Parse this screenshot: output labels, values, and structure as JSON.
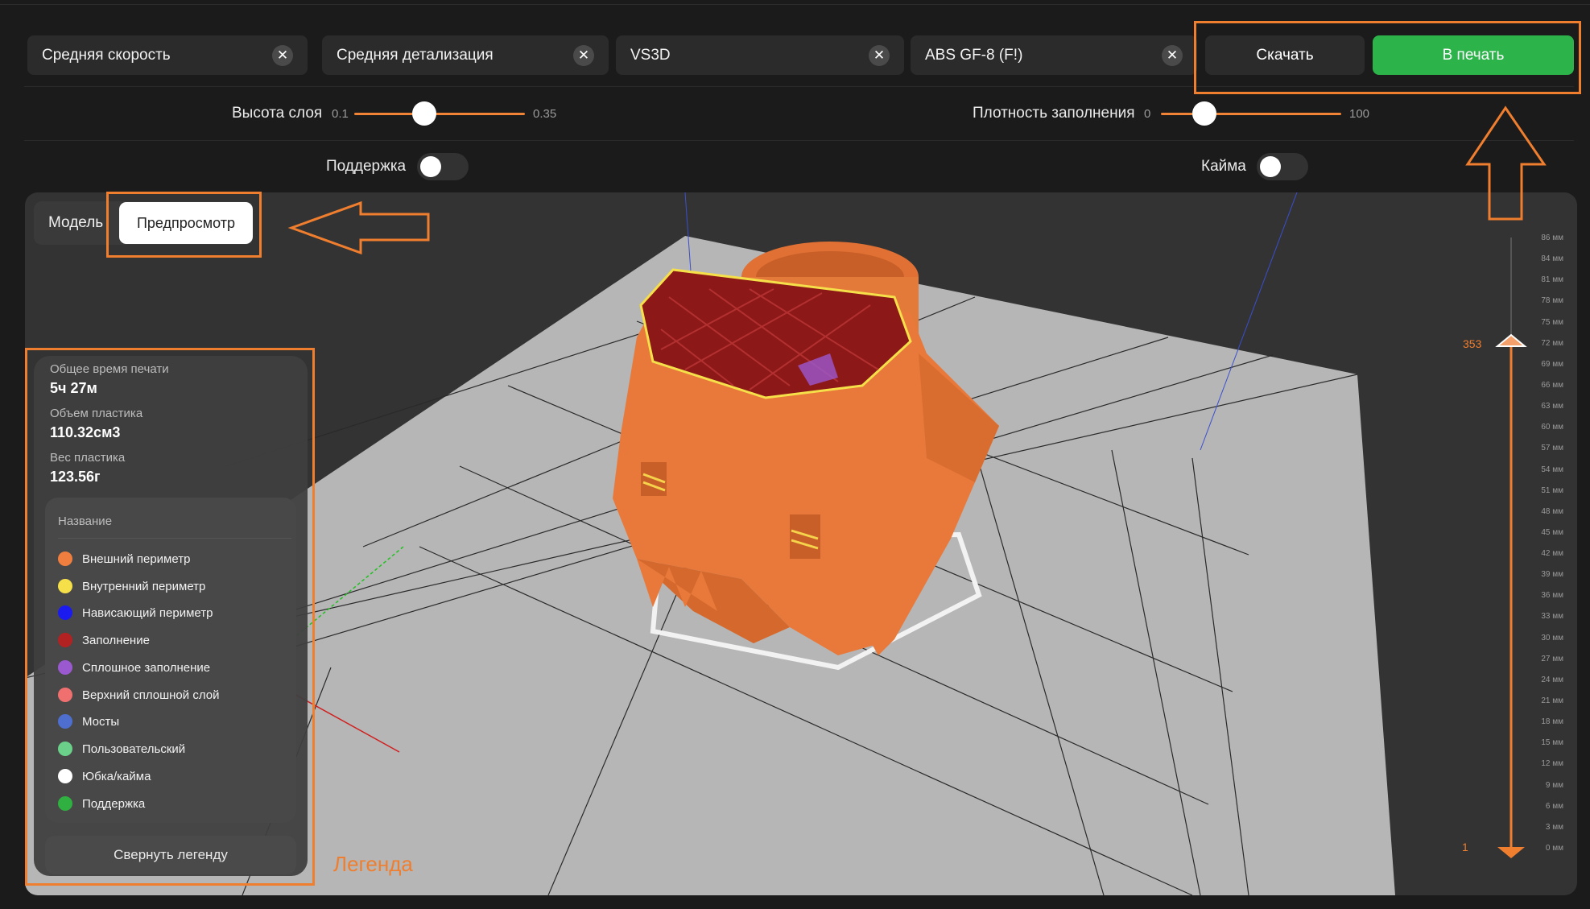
{
  "filters": [
    {
      "label": "Средняя скорость"
    },
    {
      "label": "Средняя детализация"
    },
    {
      "label": "VS3D"
    },
    {
      "label": "ABS GF-8 (F!)"
    }
  ],
  "close_glyph": "✕",
  "actions": {
    "download_label": "Скачать",
    "print_label": "В печать"
  },
  "layer_height": {
    "label": "Высота слоя",
    "min": "0.1",
    "max": "0.35",
    "value_fraction": 0.41
  },
  "infill_density": {
    "label": "Плотность заполнения",
    "min": "0",
    "max": "100",
    "value_fraction": 0.24
  },
  "support": {
    "label": "Поддержка",
    "enabled": false
  },
  "brim": {
    "label": "Кайма",
    "enabled": false
  },
  "view_tabs": {
    "model": "Модель",
    "preview": "Предпросмотр",
    "active": "preview"
  },
  "stats": {
    "print_time_label": "Общее время печати",
    "print_time_value": "5ч 27м",
    "volume_label": "Объем пластика",
    "volume_value": "110.32см3",
    "weight_label": "Вес пластика",
    "weight_value": "123.56г"
  },
  "legend": {
    "title": "Название",
    "items": [
      {
        "label": "Внешний периметр",
        "color": "#f07e3e"
      },
      {
        "label": "Внутренний периметр",
        "color": "#f5e04a"
      },
      {
        "label": "Нависающий периметр",
        "color": "#1b1bf0"
      },
      {
        "label": "Заполнение",
        "color": "#b22222"
      },
      {
        "label": "Сплошное заполнение",
        "color": "#9b59d0"
      },
      {
        "label": "Верхний сплошной слой",
        "color": "#f07070"
      },
      {
        "label": "Мосты",
        "color": "#4f6fd0"
      },
      {
        "label": "Пользовательский",
        "color": "#6ad08a"
      },
      {
        "label": "Юбка/кайма",
        "color": "#ffffff"
      },
      {
        "label": "Поддержка",
        "color": "#2fb040"
      }
    ],
    "collapse_label": "Свернуть легенду"
  },
  "legend_caption": "Легенда",
  "layer_ruler": {
    "labels": [
      "86 мм",
      "84 мм",
      "81 мм",
      "78 мм",
      "75 мм",
      "72 мм",
      "69 мм",
      "66 мм",
      "63 мм",
      "60 мм",
      "57 мм",
      "54 мм",
      "51 мм",
      "48 мм",
      "45 мм",
      "42 мм",
      "39 мм",
      "36 мм",
      "33 мм",
      "30 мм",
      "27 мм",
      "24 мм",
      "21 мм",
      "18 мм",
      "15 мм",
      "12 мм",
      "9 мм",
      "6 мм",
      "3 мм",
      "0 мм"
    ],
    "top_layer": "353",
    "bottom_layer": "1"
  },
  "colors": {
    "accent": "#f07e2f",
    "print_button": "#2cb34a",
    "model_orange": "#e8793a",
    "bed": "#b5b5b5"
  }
}
